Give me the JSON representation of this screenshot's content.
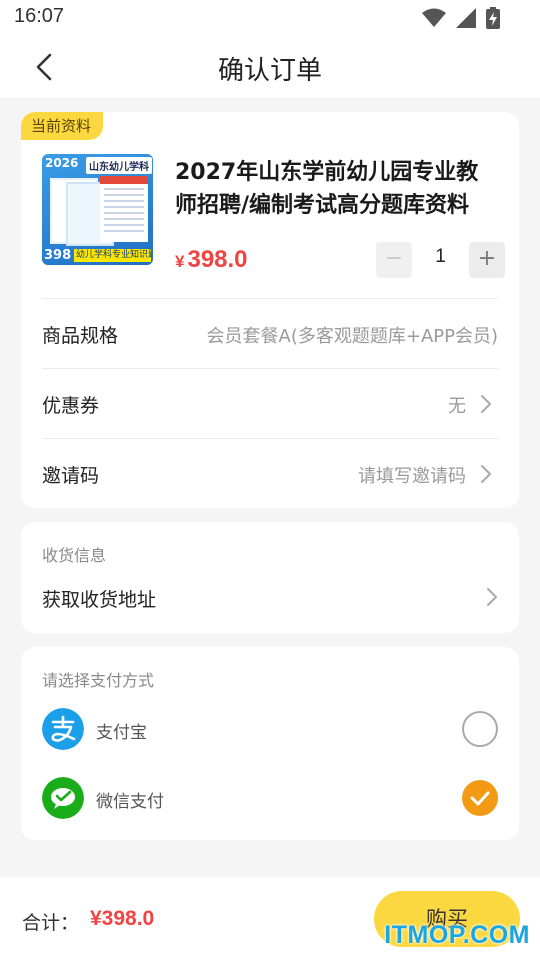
{
  "status_bar": {
    "time": "16:07",
    "icons": [
      "wifi-icon",
      "signal-icon",
      "battery-charging-icon"
    ]
  },
  "nav": {
    "title": "确认订单",
    "back_icon": "chevron-left-icon"
  },
  "product": {
    "tag": "当前资料",
    "cover": {
      "year": "2026",
      "brand": "山东幼儿学科",
      "price": "398",
      "strip": "幼儿学科专业知识题库"
    },
    "title": "2027年山东学前幼儿园专业教师招聘/编制考试高分题库资料",
    "currency": "¥",
    "price": "398.0",
    "quantity": "1",
    "minus": "−",
    "plus": "+"
  },
  "rows": [
    {
      "label": "商品规格",
      "value": "会员套餐A(多客观题题库+APP会员)"
    },
    {
      "label": "优惠券",
      "value": "无"
    },
    {
      "label": "邀请码",
      "value": "请填写邀请码"
    }
  ],
  "shipping": {
    "section_title": "收货信息",
    "action": "获取收货地址"
  },
  "payment": {
    "section_title": "请选择支付方式",
    "methods": [
      {
        "name": "支付宝",
        "icon": "alipay-icon",
        "selected": false,
        "color": "#1a9fe8"
      },
      {
        "name": "微信支付",
        "icon": "wechat-pay-icon",
        "selected": true,
        "color": "#1aad19"
      }
    ],
    "selected_color": "#f29a14"
  },
  "footer": {
    "total_label": "合计：",
    "total_amount": "¥398.0",
    "buy_label": "购买"
  },
  "watermark": "ITMOP.COM",
  "colors": {
    "accent": "#fcd840",
    "price": "#f04343",
    "background": "#f5f5f5"
  }
}
